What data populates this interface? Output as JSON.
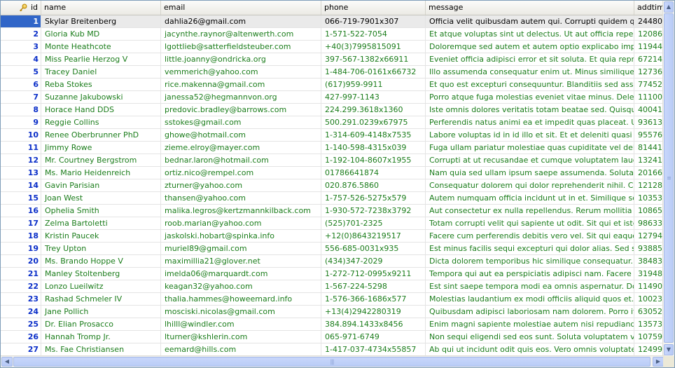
{
  "columns": {
    "id": "id",
    "name": "name",
    "email": "email",
    "phone": "phone",
    "message": "message",
    "addtime": "addtime"
  },
  "icons": {
    "key": "key-icon",
    "scroll_up": "arrow-up-icon",
    "scroll_down": "arrow-down-icon",
    "scroll_left": "arrow-left-icon",
    "scroll_right": "arrow-right-icon"
  },
  "selected_row": 1,
  "rows": [
    {
      "id": "1",
      "name": "Skylar Breitenberg",
      "email": "dahlia26@gmail.com",
      "phone": "066-719-7901x307",
      "message": "Officia velit quibusdam autem qui. Corrupti quidem quos r...",
      "addtime": "24480..."
    },
    {
      "id": "2",
      "name": "Gloria Kub MD",
      "email": "jacynthe.raynor@altenwerth.com",
      "phone": "1-571-522-7054",
      "message": "Et atque voluptas sint ut delectus. Ut aut officia repellen...",
      "addtime": "12086..."
    },
    {
      "id": "3",
      "name": "Monte Heathcote",
      "email": "lgottlieb@satterfieldsteuber.com",
      "phone": "+40(3)7995815091",
      "message": "Doloremque sed autem et autem optio explicabo impedit. ...",
      "addtime": "11944..."
    },
    {
      "id": "4",
      "name": "Miss Pearlie Herzog V",
      "email": "little.joanny@ondricka.org",
      "phone": "397-567-1382x66911",
      "message": "Eveniet officia adipisci error et sit soluta. Et quia reprehe...",
      "addtime": "67214..."
    },
    {
      "id": "5",
      "name": "Tracey Daniel",
      "email": "vemmerich@yahoo.com",
      "phone": "1-484-706-0161x66732",
      "message": "Illo assumenda consequatur enim ut. Minus similique nisi i...",
      "addtime": "12736..."
    },
    {
      "id": "6",
      "name": "Reba Stokes",
      "email": "rice.makenna@gmail.com",
      "phone": "(617)959-9911",
      "message": "Et quo est excepturi consequuntur. Blanditiis sed assumen...",
      "addtime": "77452..."
    },
    {
      "id": "7",
      "name": "Suzanne Jakubowski",
      "email": "janessa52@hegmannvon.org",
      "phone": "427-997-1143",
      "message": "Porro atque fuga molestias eveniet vitae minus. Deleniti ...",
      "addtime": "11100..."
    },
    {
      "id": "8",
      "name": "Horace Hand DDS",
      "email": "predovic.bradley@barrows.com",
      "phone": "224.299.3618x1360",
      "message": "Iste omnis dolores veritatis totam beatae sed. Quisquam ...",
      "addtime": "40041..."
    },
    {
      "id": "9",
      "name": "Reggie Collins",
      "email": "sstokes@gmail.com",
      "phone": "500.291.0239x67975",
      "message": "Perferendis natus animi ea et impedit quas placeat. Ut si...",
      "addtime": "93613..."
    },
    {
      "id": "10",
      "name": "Renee Oberbrunner PhD",
      "email": "ghowe@hotmail.com",
      "phone": "1-314-609-4148x7535",
      "message": "Labore voluptas id in id illo et sit. Et et deleniti quasi error...",
      "addtime": "95576..."
    },
    {
      "id": "11",
      "name": "Jimmy Rowe",
      "email": "zieme.elroy@mayer.com",
      "phone": "1-140-598-4315x039",
      "message": "Fuga ullam pariatur molestiae quas cupiditate vel deleniti...",
      "addtime": "81441..."
    },
    {
      "id": "12",
      "name": "Mr. Courtney Bergstrom",
      "email": "bednar.laron@hotmail.com",
      "phone": "1-192-104-8607x1955",
      "message": "Corrupti at ut recusandae et cumque voluptatem laudanti...",
      "addtime": "13241..."
    },
    {
      "id": "13",
      "name": "Ms. Mario Heidenreich",
      "email": "ortiz.nico@rempel.com",
      "phone": "01786641874",
      "message": "Nam quia sed ullam ipsum saepe assumenda. Soluta beat...",
      "addtime": "20166..."
    },
    {
      "id": "14",
      "name": "Gavin Parisian",
      "email": "zturner@yahoo.com",
      "phone": "020.876.5860",
      "message": "Consequatur dolorem qui dolor reprehenderit nihil. Culpa ...",
      "addtime": "12128..."
    },
    {
      "id": "15",
      "name": "Joan West",
      "email": "thansen@yahoo.com",
      "phone": "1-757-526-5275x579",
      "message": "Autem numquam officia incidunt ut in et. Similique sequi v...",
      "addtime": "10353..."
    },
    {
      "id": "16",
      "name": "Ophelia Smith",
      "email": "malika.legros@kertzmannkilback.com",
      "phone": "1-930-572-7238x3792",
      "message": "Aut consectetur ex nulla repellendus. Rerum mollitia qui a...",
      "addtime": "10865..."
    },
    {
      "id": "17",
      "name": "Zelma Bartoletti",
      "email": "roob.marian@yahoo.com",
      "phone": "(525)701-2325",
      "message": "Totam corrupti velit qui sapiente ut odit. Sit qui et iste est...",
      "addtime": "98633..."
    },
    {
      "id": "18",
      "name": "Kristin Paucek",
      "email": "jaskolski.hobart@spinka.info",
      "phone": "+12(0)8643219517",
      "message": "Facere cum perferendis debitis vero vel. Sit qui eaque re...",
      "addtime": "12794..."
    },
    {
      "id": "19",
      "name": "Trey Upton",
      "email": "muriel89@gmail.com",
      "phone": "556-685-0031x935",
      "message": "Est minus facilis sequi excepturi qui dolor alias. Sed sunt ...",
      "addtime": "93885..."
    },
    {
      "id": "20",
      "name": "Ms. Brando Hoppe V",
      "email": "maximillia21@glover.net",
      "phone": "(434)347-2029",
      "message": "Dicta dolorem temporibus hic similique consequatur. Quod...",
      "addtime": "38483..."
    },
    {
      "id": "21",
      "name": "Manley Stoltenberg",
      "email": "imelda06@marquardt.com",
      "phone": "1-272-712-0995x9211",
      "message": "Tempora qui aut ea perspiciatis adipisci nam. Facere blan...",
      "addtime": "31948..."
    },
    {
      "id": "22",
      "name": "Lonzo Lueilwitz",
      "email": "keagan32@yahoo.com",
      "phone": "1-567-224-5298",
      "message": "Est sint saepe tempora modi ea omnis aspernatur. Dolore...",
      "addtime": "11490..."
    },
    {
      "id": "23",
      "name": "Rashad Schmeler IV",
      "email": "thalia.hammes@howeemard.info",
      "phone": "1-576-366-1686x577",
      "message": "Molestias laudantium ex modi officiis aliquid quos et. Anim...",
      "addtime": "10023..."
    },
    {
      "id": "24",
      "name": "Jane Pollich",
      "email": "mosciski.nicolas@gmail.com",
      "phone": "+13(4)2942280319",
      "message": "Quibusdam adipisci laboriosam nam dolorem. Porro itaque...",
      "addtime": "63052..."
    },
    {
      "id": "25",
      "name": "Dr. Elian Prosacco",
      "email": "lhilll@windler.com",
      "phone": "384.894.1433x8456",
      "message": "Enim magni sapiente molestiae autem nisi repudiandae bl...",
      "addtime": "13573..."
    },
    {
      "id": "26",
      "name": "Hannah Tromp Jr.",
      "email": "lturner@kshlerin.com",
      "phone": "065-971-6749",
      "message": "Non sequi eligendi sed eos sunt. Soluta voluptatem volup...",
      "addtime": "10759..."
    },
    {
      "id": "27",
      "name": "Ms. Fae Christiansen",
      "email": "eemard@hills.com",
      "phone": "1-417-037-4734x55857",
      "message": "Ab qui ut incidunt odit quis eos. Vero omnis voluptates ut ...",
      "addtime": "12499..."
    }
  ]
}
